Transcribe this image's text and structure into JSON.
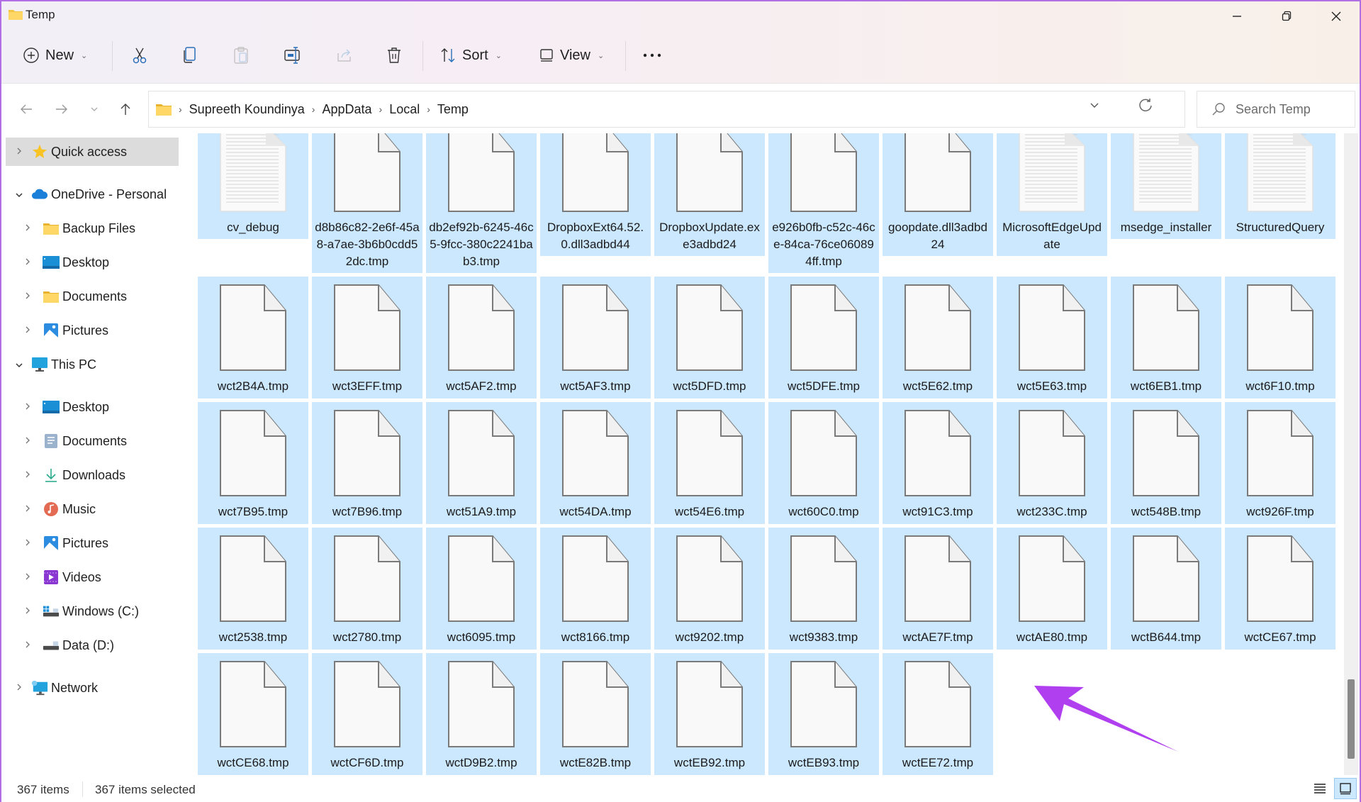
{
  "window": {
    "title": "Temp",
    "minimize_label": "Minimize",
    "maximize_label": "Restore",
    "close_label": "Close"
  },
  "toolbar": {
    "new_label": "New",
    "sort_label": "Sort",
    "view_label": "View",
    "more_label": "See more",
    "icons": [
      "plus-circle-icon",
      "cut-icon",
      "copy-icon",
      "paste-icon",
      "rename-icon",
      "share-icon",
      "delete-icon",
      "sort-icon",
      "view-icon",
      "more-icon"
    ]
  },
  "nav": {
    "breadcrumb": [
      "Supreeth Koundinya",
      "AppData",
      "Local",
      "Temp"
    ],
    "search_placeholder": "Search Temp"
  },
  "sidebar": {
    "items": [
      {
        "label": "Quick access",
        "icon": "star-icon",
        "level": 0,
        "expanded": false,
        "selected": true
      },
      {
        "label": "OneDrive - Personal",
        "icon": "cloud-icon",
        "level": 0,
        "expanded": true
      },
      {
        "label": "Backup Files",
        "icon": "folder-icon",
        "level": 1
      },
      {
        "label": "Desktop",
        "icon": "desktop-icon",
        "level": 1
      },
      {
        "label": "Documents",
        "icon": "folder-icon",
        "level": 1
      },
      {
        "label": "Pictures",
        "icon": "pictures-icon",
        "level": 1
      },
      {
        "label": "This PC",
        "icon": "monitor-icon",
        "level": 0,
        "expanded": true
      },
      {
        "label": "Desktop",
        "icon": "desktop-icon",
        "level": 1
      },
      {
        "label": "Documents",
        "icon": "documents-icon",
        "level": 1
      },
      {
        "label": "Downloads",
        "icon": "download-icon",
        "level": 1
      },
      {
        "label": "Music",
        "icon": "music-icon",
        "level": 1
      },
      {
        "label": "Pictures",
        "icon": "pictures-icon",
        "level": 1
      },
      {
        "label": "Videos",
        "icon": "videos-icon",
        "level": 1
      },
      {
        "label": "Windows (C:)",
        "icon": "drive-c-icon",
        "level": 1
      },
      {
        "label": "Data (D:)",
        "icon": "drive-d-icon",
        "level": 1
      },
      {
        "label": "Network",
        "icon": "network-icon",
        "level": 0,
        "expanded": false
      }
    ]
  },
  "files": {
    "rows": [
      [
        {
          "name": "cv_debug",
          "type": "text"
        },
        {
          "name": "d8b86c82-2e6f-45a8-a7ae-3b6b0cdd52dc.tmp",
          "type": "blank"
        },
        {
          "name": "db2ef92b-6245-46c5-9fcc-380c2241bab3.tmp",
          "type": "blank"
        },
        {
          "name": "DropboxExt64.52.0.dll3adbd44",
          "type": "blank"
        },
        {
          "name": "DropboxUpdate.exe3adbd24",
          "type": "blank"
        },
        {
          "name": "e926b0fb-c52c-46ce-84ca-76ce060894ff.tmp",
          "type": "blank"
        },
        {
          "name": "goopdate.dll3adbd24",
          "type": "blank"
        },
        {
          "name": "MicrosoftEdgeUpdate",
          "type": "text"
        },
        {
          "name": "msedge_installer",
          "type": "text"
        },
        {
          "name": "StructuredQuery",
          "type": "text"
        }
      ],
      [
        {
          "name": "wct2B4A.tmp"
        },
        {
          "name": "wct3EFF.tmp"
        },
        {
          "name": "wct5AF2.tmp"
        },
        {
          "name": "wct5AF3.tmp"
        },
        {
          "name": "wct5DFD.tmp"
        },
        {
          "name": "wct5DFE.tmp"
        },
        {
          "name": "wct5E62.tmp"
        },
        {
          "name": "wct5E63.tmp"
        },
        {
          "name": "wct6EB1.tmp"
        },
        {
          "name": "wct6F10.tmp"
        }
      ],
      [
        {
          "name": "wct7B95.tmp"
        },
        {
          "name": "wct7B96.tmp"
        },
        {
          "name": "wct51A9.tmp"
        },
        {
          "name": "wct54DA.tmp"
        },
        {
          "name": "wct54E6.tmp"
        },
        {
          "name": "wct60C0.tmp"
        },
        {
          "name": "wct91C3.tmp"
        },
        {
          "name": "wct233C.tmp"
        },
        {
          "name": "wct548B.tmp"
        },
        {
          "name": "wct926F.tmp"
        }
      ],
      [
        {
          "name": "wct2538.tmp"
        },
        {
          "name": "wct2780.tmp"
        },
        {
          "name": "wct6095.tmp"
        },
        {
          "name": "wct8166.tmp"
        },
        {
          "name": "wct9202.tmp"
        },
        {
          "name": "wct9383.tmp"
        },
        {
          "name": "wctAE7F.tmp"
        },
        {
          "name": "wctAE80.tmp"
        },
        {
          "name": "wctB644.tmp"
        },
        {
          "name": "wctCE67.tmp"
        }
      ],
      [
        {
          "name": "wctCE68.tmp"
        },
        {
          "name": "wctCF6D.tmp"
        },
        {
          "name": "wctD9B2.tmp"
        },
        {
          "name": "wctE82B.tmp"
        },
        {
          "name": "wctEB92.tmp"
        },
        {
          "name": "wctEB93.tmp"
        },
        {
          "name": "wctEE72.tmp"
        }
      ]
    ]
  },
  "status": {
    "item_count": "367 items",
    "selected_count": "367 items selected",
    "details_view_label": "Details",
    "large_icons_view_label": "Large icons"
  },
  "colors": {
    "selection": "#cce8ff",
    "annotation_arrow": "#b03ff0",
    "window_border": "#b26fe3"
  }
}
